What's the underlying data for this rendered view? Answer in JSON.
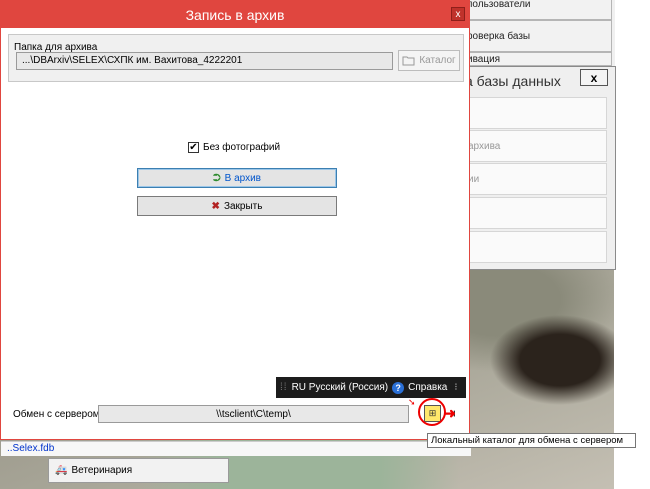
{
  "dialog": {
    "title": "Запись в архив",
    "close_glyph": "x",
    "folder_label": "Папка для архива",
    "folder_path": "...\\DBArxiv\\SELEX\\СХПК им. Вахитова_4222201",
    "catalog_button": "Каталог",
    "checkbox_label": "Без фотографий",
    "checkbox_checked": true,
    "archive_button": "В архив",
    "close_button": "Закрыть",
    "server_label": "Обмен с сервером",
    "server_path": "\\\\tsclient\\C\\temp\\",
    "statusbar_text": "..Selex.fdb"
  },
  "right_panel": {
    "top_item_1": "пользователи",
    "top_item_2": "роверка базы",
    "top_item_3": "ивация",
    "db_dialog_title": "а базы данных",
    "db_close_glyph": "x",
    "db_items": [
      "",
      "архива",
      "ии",
      "",
      ""
    ]
  },
  "langbar": {
    "language": "RU Русский (Россия)",
    "help": "Справка",
    "help_glyph": "?"
  },
  "tooltip": "Локальный каталог для обмена с сервером",
  "bottom": {
    "vet_button": "Ветеринария"
  },
  "icons": {
    "catalog": "folder-icon",
    "archive": "archive-arrow-icon",
    "close": "close-people-icon",
    "server_local": "local-folder-icon",
    "server_exit": "exit-icon",
    "vet": "vet-car-icon"
  },
  "colors": {
    "titlebar": "#e0463f",
    "highlight_circle": "#ee0000",
    "status_link": "#0033cc"
  }
}
